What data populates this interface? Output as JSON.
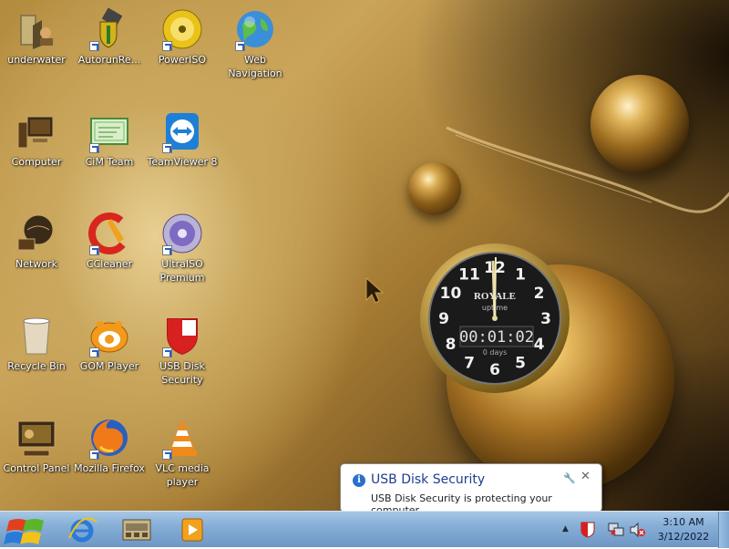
{
  "desktop_icons": [
    {
      "label": "underwater",
      "icon": "folder-icon"
    },
    {
      "label": "AutorunRe...",
      "icon": "usb-shield-icon"
    },
    {
      "label": "PowerISO",
      "icon": "disc-icon"
    },
    {
      "label": "Web Navigation",
      "icon": "globe-icon"
    },
    {
      "label": "Computer",
      "icon": "computer-icon"
    },
    {
      "label": "CiM Team",
      "icon": "certificate-icon"
    },
    {
      "label": "TeamViewer 8",
      "icon": "teamviewer-icon"
    },
    {
      "label": "Network",
      "icon": "network-icon"
    },
    {
      "label": "CCleaner",
      "icon": "ccleaner-icon"
    },
    {
      "label": "UltraISO Premium",
      "icon": "ultraiso-icon"
    },
    {
      "label": "Recycle Bin",
      "icon": "recycle-bin-icon"
    },
    {
      "label": "GOM Player",
      "icon": "gom-player-icon"
    },
    {
      "label": "USB Disk Security",
      "icon": "usb-disk-security-icon"
    },
    {
      "label": "Control Panel",
      "icon": "control-panel-icon"
    },
    {
      "label": "Mozilla Firefox",
      "icon": "firefox-icon"
    },
    {
      "label": "VLC media player",
      "icon": "vlc-icon"
    }
  ],
  "clock_gadget": {
    "brand": "ROYALE",
    "sub_brand": "uptime",
    "uptime": "00:01:02",
    "days": "0 days",
    "numerals": [
      "12",
      "1",
      "2",
      "3",
      "4",
      "5",
      "6",
      "7",
      "8",
      "9",
      "10",
      "11"
    ]
  },
  "notification": {
    "title": "USB Disk Security",
    "body": "USB Disk Security is protecting your computer"
  },
  "taskbar": {
    "pinned": [
      "ie-icon",
      "explorer-icon",
      "media-player-icon"
    ],
    "tray_icons": [
      "usb-disk-security-tray-icon",
      "network-tray-icon",
      "volume-muted-icon"
    ],
    "time": "3:10 AM",
    "date": "3/12/2022"
  },
  "colors": {
    "taskbar": "#86aed6",
    "balloon_title": "#1e3d8f"
  }
}
